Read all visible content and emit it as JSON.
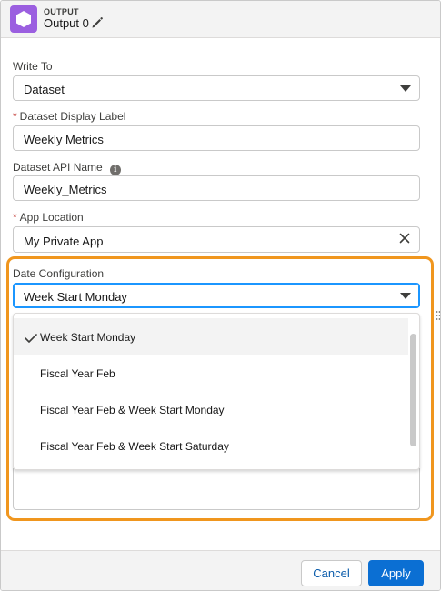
{
  "header": {
    "eyebrow": "OUTPUT",
    "node_name": "Output 0",
    "icon": "hexagon-icon",
    "edit_icon": "pencil-icon",
    "icon_color": "#9b5fe0"
  },
  "form": {
    "write_to": {
      "label": "Write To",
      "value": "Dataset"
    },
    "display_label": {
      "label": "Dataset Display Label",
      "required": "*",
      "value": "Weekly Metrics"
    },
    "api_name": {
      "label": "Dataset API Name",
      "info": "i",
      "value": "Weekly_Metrics"
    },
    "app_location": {
      "label": "App Location",
      "required": "*",
      "value": "My Private App"
    },
    "date_config": {
      "label": "Date Configuration",
      "value": "Week Start Monday"
    }
  },
  "dropdown": {
    "options": [
      {
        "label": "Week Start Monday",
        "selected": true
      },
      {
        "label": "Fiscal Year Feb",
        "selected": false
      },
      {
        "label": "Fiscal Year Feb & Week Start Monday",
        "selected": false
      },
      {
        "label": "Fiscal Year Feb & Week Start Saturday",
        "selected": false
      }
    ]
  },
  "footer": {
    "cancel_label": "Cancel",
    "apply_label": "Apply"
  },
  "colors": {
    "highlight": "#f0961e",
    "brand": "#0b6fd3",
    "focus": "#1b96ff"
  }
}
